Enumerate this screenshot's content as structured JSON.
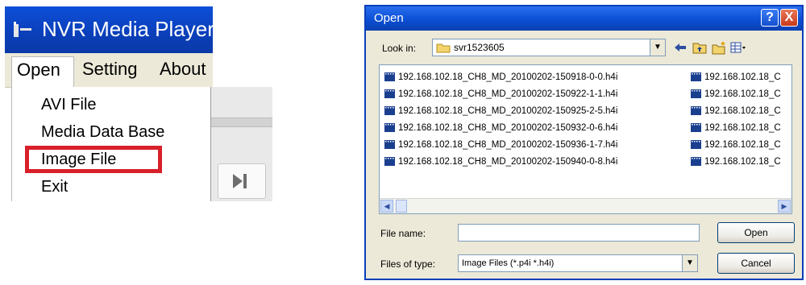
{
  "nvr": {
    "title": "NVR Media Player",
    "menubar": [
      "Open",
      "Setting",
      "About"
    ],
    "open_menu": [
      "AVI File",
      "Media Data Base",
      "Image File",
      "Exit"
    ],
    "highlighted_item": "Image File",
    "highlight_color": "#d8202a"
  },
  "dialog": {
    "title": "Open",
    "help_button": "?",
    "close_button": "X",
    "look_in_label": "Look in:",
    "look_in_value": "svr1523605",
    "files_col1": [
      "192.168.102.18_CH8_MD_20100202-150918-0-0.h4i",
      "192.168.102.18_CH8_MD_20100202-150922-1-1.h4i",
      "192.168.102.18_CH8_MD_20100202-150925-2-5.h4i",
      "192.168.102.18_CH8_MD_20100202-150932-0-6.h4i",
      "192.168.102.18_CH8_MD_20100202-150936-1-7.h4i",
      "192.168.102.18_CH8_MD_20100202-150940-0-8.h4i"
    ],
    "files_col2": [
      "192.168.102.18_C",
      "192.168.102.18_C",
      "192.168.102.18_C",
      "192.168.102.18_C",
      "192.168.102.18_C",
      "192.168.102.18_C"
    ],
    "file_name_label": "File name:",
    "file_name_value": "",
    "files_of_type_label": "Files of type:",
    "files_of_type_value": "Image Files (*.p4i *.h4i)",
    "open_button": "Open",
    "cancel_button": "Cancel"
  },
  "colors": {
    "titlebar_blue": "#0b4fd4",
    "dialog_face": "#ece9d8",
    "file_icon": "#1a3f8f"
  }
}
